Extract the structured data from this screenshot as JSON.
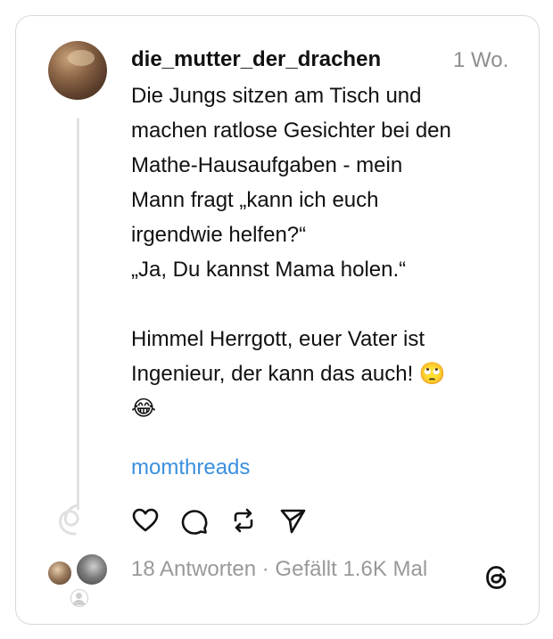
{
  "post": {
    "username": "die_mutter_der_drachen",
    "time": "1 Wo.",
    "lines": [
      "Die Jungs sitzen am Tisch und",
      "machen ratlose Gesichter bei den",
      "Mathe-Hausaufgaben - mein",
      "Mann fragt „kann ich euch",
      "irgendwie helfen?“",
      "„Ja, Du kannst Mama holen.“",
      "",
      "Himmel Herrgott, euer Vater ist",
      "Ingenieur, der kann das auch! 🙄",
      "😂"
    ],
    "hashtag": "momthreads",
    "stats": "18 Antworten · Gefällt 1.6K Mal"
  },
  "icons": {
    "like": "heart-icon",
    "reply": "comment-icon",
    "repost": "repost-icon",
    "share": "send-icon",
    "logo": "threads-logo-icon"
  },
  "colors": {
    "hashtag": "#3a8fde",
    "muted": "#8e8e8e",
    "border": "#d9d9d9"
  }
}
